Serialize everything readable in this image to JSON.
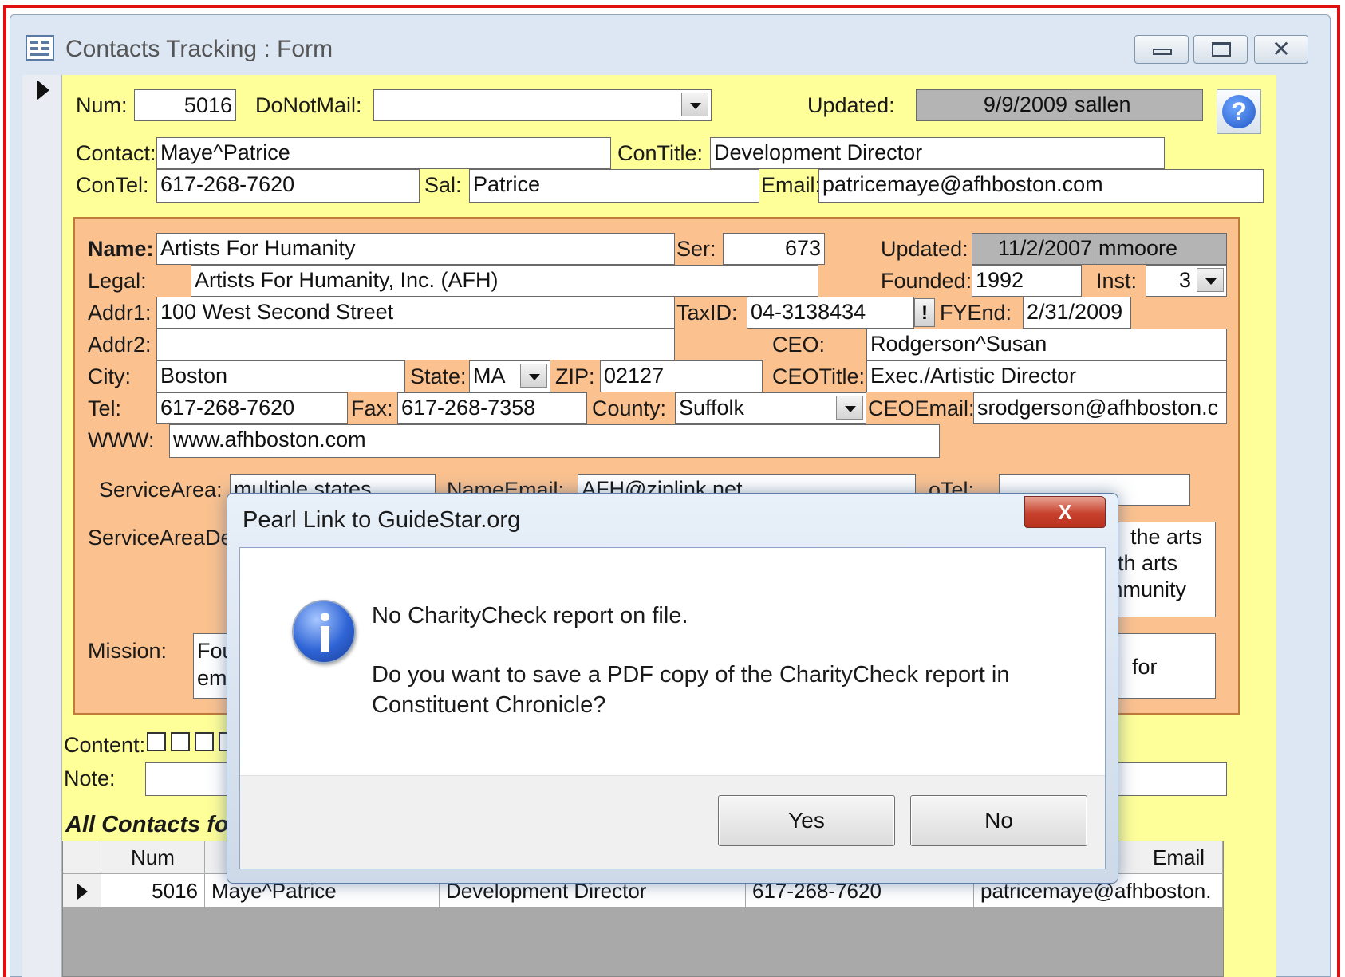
{
  "window": {
    "title": "Contacts Tracking : Form"
  },
  "contact": {
    "num_label": "Num:",
    "num": "5016",
    "donotmail_label": "DoNotMail:",
    "donotmail": "",
    "updated_label": "Updated:",
    "updated_date": "9/9/2009",
    "updated_by": "sallen",
    "contact_label": "Contact:",
    "contact": "Maye^Patrice",
    "contitle_label": "ConTitle:",
    "contitle": "Development Director",
    "contel_label": "ConTel:",
    "contel": "617-268-7620",
    "sal_label": "Sal:",
    "sal": "Patrice",
    "email_label": "Email:",
    "email": "patricemaye@afhboston.com"
  },
  "org": {
    "name_label": "Name:",
    "name": "Artists For Humanity",
    "ser_label": "Ser:",
    "ser": "673",
    "updated_label": "Updated:",
    "updated_date": "11/2/2007",
    "updated_by": "mmoore",
    "legal_label": "Legal:",
    "legal": "Artists For Humanity, Inc. (AFH)",
    "founded_label": "Founded:",
    "founded": "1992",
    "inst_label": "Inst:",
    "inst": "3",
    "addr1_label": "Addr1:",
    "addr1": "100 West Second Street",
    "taxid_label": "TaxID:",
    "taxid": "04-3138434",
    "taxid_btn": "!",
    "fyend_label": "FYEnd:",
    "fyend": "2/31/2009",
    "addr2_label": "Addr2:",
    "addr2": "",
    "ceo_label": "CEO:",
    "ceo": "Rodgerson^Susan",
    "city_label": "City:",
    "city": "Boston",
    "state_label": "State:",
    "state": "MA",
    "zip_label": "ZIP:",
    "zip": "02127",
    "ceotitle_label": "CEOTitle:",
    "ceotitle": "Exec./Artistic Director",
    "tel_label": "Tel:",
    "tel": "617-268-7620",
    "fax_label": "Fax:",
    "fax": "617-268-7358",
    "county_label": "County:",
    "county": "Suffolk",
    "ceoemail_label": "CEOEmail:",
    "ceoemail": "srodgerson@afhboston.c",
    "www_label": "WWW:",
    "www": "www.afhboston.com",
    "servicearea_label": "ServiceArea:",
    "servicearea": "multiple states",
    "nameemail_label": "NameEmail:",
    "nameemail": "AFH@ziplink.net",
    "otel_label": "oTel:",
    "otel": "",
    "serviceareadesc_label": "ServiceAreaDe",
    "serviceareadesc_lines": [
      "the arts",
      "th arts",
      "mmunity"
    ],
    "mission_label": "Mission:",
    "mission_left": [
      "Fou",
      "em"
    ],
    "mission_right": "for"
  },
  "lower": {
    "content_label": "Content:",
    "note_label": "Note:",
    "note": "",
    "section_title": "All Contacts fo",
    "grid": {
      "headers": {
        "num": "Num",
        "email": "Email"
      },
      "row": {
        "num": "5016",
        "contact": "Maye^Patrice",
        "title": "Development Director",
        "tel": "617-268-7620",
        "email": "patricemaye@afhboston."
      }
    }
  },
  "dialog": {
    "title": "Pearl Link to GuideStar.org",
    "close": "X",
    "message1": "No CharityCheck report on file.",
    "message2": "Do you want to save a PDF copy of the CharityCheck report in",
    "message3": "Constituent Chronicle?",
    "yes": "Yes",
    "no": "No"
  },
  "colors": {
    "form_bg": "#ffff99",
    "org_bg": "#fbc290",
    "red_border": "#e01010",
    "chrome": "#dbe5f1"
  }
}
